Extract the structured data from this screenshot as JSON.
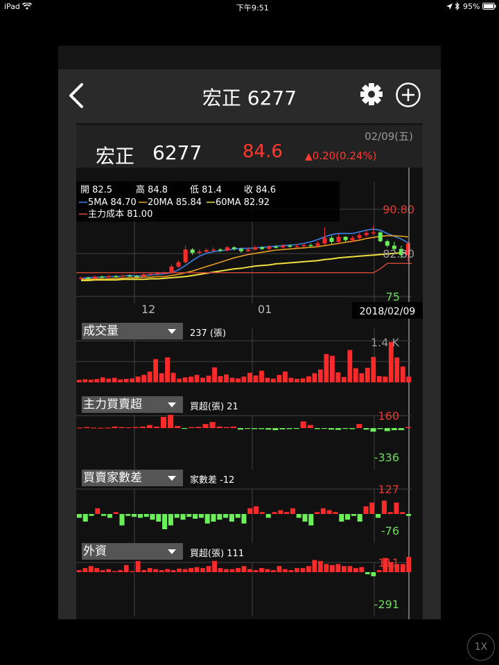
{
  "status_bar": {
    "device": "iPad",
    "time": "下午9:51",
    "battery": "95%"
  },
  "header": {
    "title": "宏正 6277"
  },
  "quote": {
    "date": "02/09(五)",
    "name": "宏正",
    "code": "6277",
    "price": "84.6",
    "change": "0.20(0.24%)",
    "change_color": "#ff3b30"
  },
  "ohlc": {
    "open": "開 82.5",
    "high": "高 84.8",
    "low": "低 81.4",
    "close": "收 84.6"
  },
  "ma": {
    "ma5": "5MA 84.70",
    "ma20": "20MA 85.84",
    "ma60": "60MA 82.92",
    "cost": "主力成本 81.00"
  },
  "price_axis": {
    "top": "90.80",
    "mid": "82.80",
    "bottom": "75"
  },
  "x_axis": {
    "dec": "12",
    "jan": "01"
  },
  "crosshair_date": "2018/02/09",
  "colors": {
    "up": "#ff2a2a",
    "down": "#6cf05a",
    "ma5": "#3d82e6",
    "ma20": "#e8a020",
    "ma60": "#f0e040",
    "cost": "#d9483b",
    "background": "#111111"
  },
  "indicators": [
    {
      "label": "成交量",
      "value": "237 (張)",
      "axis_top": "1.4 K",
      "axis_bottom": ""
    },
    {
      "label": "主力買賣超",
      "value": "買超(張) 21",
      "axis_top": "160",
      "axis_bottom": "-336"
    },
    {
      "label": "買賣家數差",
      "value": "家數差 -12",
      "axis_top": "127",
      "axis_bottom": "-76"
    },
    {
      "label": "外資",
      "value": "買超(張) 111",
      "axis_top": "111",
      "axis_bottom": "-291"
    }
  ],
  "zoom_label": "1X",
  "chart_data": [
    {
      "type": "candlestick",
      "title": "",
      "y_range": [
        75,
        90.8
      ],
      "series": [
        {
          "name": "5MA",
          "values": [
            78.3,
            78.4,
            78.5,
            78.5,
            78.6,
            78.6,
            78.7,
            78.8,
            78.7,
            78.8,
            78.9,
            79.0,
            79.1,
            79.3,
            79.8,
            80.6,
            81.5,
            82.3,
            82.8,
            83.1,
            83.3,
            83.4,
            83.6,
            83.7,
            83.7,
            83.8,
            83.9,
            84.0,
            84.1,
            84.2,
            84.3,
            84.4,
            84.6,
            84.9,
            85.3,
            85.8,
            86.2,
            86.4,
            86.4,
            86.4,
            86.7,
            87.0,
            87.2,
            87.0,
            86.4,
            85.9,
            85.4,
            84.7
          ]
        },
        {
          "name": "20MA",
          "values": [
            78.1,
            78.1,
            78.2,
            78.2,
            78.2,
            78.3,
            78.3,
            78.4,
            78.4,
            78.5,
            78.5,
            78.6,
            78.6,
            78.8,
            79.0,
            79.3,
            79.6,
            80.0,
            80.4,
            80.8,
            81.2,
            81.6,
            82.0,
            82.3,
            82.6,
            82.8,
            83.0,
            83.2,
            83.4,
            83.5,
            83.6,
            83.7,
            83.8,
            83.9,
            84.0,
            84.2,
            84.4,
            84.6,
            84.8,
            85.0,
            85.2,
            85.5,
            85.7,
            85.9,
            86.0,
            86.0,
            85.9,
            85.8
          ]
        },
        {
          "name": "60MA",
          "values": [
            77.9,
            77.9,
            78.0,
            78.0,
            78.0,
            78.0,
            78.1,
            78.1,
            78.1,
            78.1,
            78.2,
            78.2,
            78.3,
            78.4,
            78.5,
            78.6,
            78.8,
            79.0,
            79.2,
            79.4,
            79.6,
            79.8,
            80.0,
            80.1,
            80.3,
            80.5,
            80.6,
            80.7,
            80.9,
            81.0,
            81.1,
            81.2,
            81.3,
            81.4,
            81.5,
            81.7,
            81.8,
            82.0,
            82.1,
            82.2,
            82.3,
            82.4,
            82.5,
            82.6,
            82.7,
            82.8,
            82.9,
            82.9
          ]
        },
        {
          "name": "主力成本",
          "values": [
            79.3,
            79.3,
            79.3,
            79.3,
            79.3,
            79.3,
            79.3,
            79.3,
            79.3,
            79.3,
            79.3,
            79.3,
            79.3,
            79.3,
            79.3,
            79.3,
            79.3,
            79.3,
            79.3,
            79.3,
            79.3,
            79.3,
            79.3,
            79.3,
            79.3,
            79.3,
            79.3,
            79.3,
            79.3,
            79.3,
            79.3,
            79.3,
            79.3,
            79.3,
            79.3,
            79.3,
            79.3,
            79.3,
            79.3,
            79.3,
            79.3,
            79.3,
            79.3,
            80.0,
            81.0,
            81.0,
            81.0,
            81.0
          ]
        }
      ],
      "open": [
        78.2,
        78.4,
        78.3,
        78.6,
        78.5,
        78.7,
        78.6,
        78.8,
        78.7,
        78.6,
        79.0,
        79.1,
        79.2,
        79.3,
        80.4,
        81.2,
        83.5,
        82.9,
        83.1,
        83.4,
        83.5,
        83.3,
        83.9,
        83.6,
        83.2,
        83.5,
        83.9,
        83.6,
        84.0,
        83.9,
        84.2,
        84.0,
        84.1,
        84.3,
        84.2,
        84.6,
        85.6,
        84.9,
        85.8,
        85.2,
        85.6,
        86.1,
        86.5,
        86.6,
        85.0,
        84.2,
        83.6,
        82.5
      ],
      "close": [
        78.4,
        78.3,
        78.6,
        78.5,
        78.7,
        78.6,
        78.8,
        78.7,
        78.6,
        79.0,
        79.1,
        79.2,
        79.3,
        80.4,
        81.2,
        83.5,
        82.9,
        83.1,
        83.4,
        83.5,
        83.3,
        83.9,
        83.6,
        83.2,
        83.5,
        83.9,
        83.6,
        84.0,
        83.9,
        84.2,
        84.0,
        84.1,
        84.3,
        84.2,
        84.6,
        85.6,
        84.9,
        85.8,
        85.2,
        85.6,
        86.1,
        86.5,
        86.6,
        85.0,
        84.2,
        83.6,
        82.5,
        84.6
      ],
      "high": [
        78.6,
        78.6,
        78.8,
        78.8,
        78.9,
        78.9,
        79.0,
        79.0,
        78.9,
        79.2,
        79.3,
        79.4,
        79.5,
        80.8,
        81.6,
        84.2,
        83.8,
        83.5,
        83.8,
        83.9,
        83.8,
        84.2,
        84.1,
        83.8,
        83.9,
        84.2,
        84.1,
        84.3,
        84.3,
        84.5,
        84.4,
        84.5,
        84.6,
        84.6,
        85.0,
        87.5,
        86.0,
        86.3,
        85.9,
        86.0,
        86.5,
        87.0,
        87.8,
        86.8,
        85.3,
        84.9,
        84.2,
        84.8
      ],
      "low": [
        78.0,
        78.1,
        78.1,
        78.3,
        78.3,
        78.4,
        78.4,
        78.5,
        78.4,
        78.4,
        78.8,
        78.9,
        79.0,
        79.1,
        80.1,
        81.0,
        82.5,
        82.6,
        82.9,
        83.2,
        83.0,
        83.1,
        83.3,
        82.9,
        83.0,
        83.3,
        83.4,
        83.4,
        83.7,
        83.7,
        83.8,
        83.8,
        83.9,
        84.0,
        84.0,
        84.3,
        84.5,
        84.6,
        84.9,
        84.9,
        85.3,
        85.8,
        86.2,
        84.8,
        83.9,
        83.2,
        81.9,
        81.4
      ]
    },
    {
      "type": "bar",
      "title": "成交量",
      "values": [
        60,
        75,
        65,
        80,
        120,
        90,
        110,
        70,
        85,
        95,
        140,
        180,
        260,
        560,
        220,
        600,
        230,
        90,
        120,
        140,
        180,
        110,
        160,
        360,
        150,
        190,
        110,
        95,
        140,
        230,
        165,
        280,
        110,
        90,
        180,
        260,
        110,
        85,
        95,
        145,
        220,
        310,
        680,
        640,
        240,
        130,
        780,
        340,
        220,
        350,
        610,
        150,
        140,
        970,
        600,
        380,
        140
      ]
    },
    {
      "type": "bar",
      "title": "主力買賣超",
      "values": [
        10,
        20,
        10,
        5,
        10,
        30,
        20,
        15,
        20,
        30,
        60,
        30,
        220,
        260,
        40,
        -10,
        20,
        25,
        80,
        120,
        30,
        20,
        30,
        -30,
        -10,
        -20,
        -20,
        -30,
        -40,
        -25,
        -20,
        -10,
        130,
        60,
        -20,
        -10,
        -30,
        -35,
        -10,
        -20,
        80,
        -30,
        -70,
        -20,
        -60,
        -40,
        -40,
        20
      ]
    },
    {
      "type": "bar",
      "title": "買賣家數差",
      "values": [
        -20,
        -40,
        -10,
        30,
        -10,
        -20,
        10,
        -60,
        -10,
        -15,
        -20,
        -15,
        -30,
        -40,
        -80,
        -60,
        -20,
        -30,
        -15,
        -25,
        -20,
        -50,
        -40,
        -30,
        -20,
        -40,
        -20,
        -50,
        30,
        40,
        10,
        -20,
        10,
        20,
        10,
        30,
        -20,
        -40,
        -60,
        10,
        30,
        20,
        10,
        -40,
        -30,
        -10,
        -40,
        40,
        60,
        -20,
        70,
        10,
        60,
        10,
        -10
      ]
    },
    {
      "type": "bar",
      "title": "外資",
      "values": [
        20,
        40,
        60,
        40,
        20,
        30,
        10,
        20,
        70,
        10,
        110,
        20,
        40,
        30,
        20,
        30,
        20,
        35,
        30,
        40,
        50,
        40,
        60,
        110,
        40,
        30,
        30,
        40,
        60,
        30,
        20,
        40,
        30,
        20,
        60,
        30,
        20,
        40,
        40,
        60,
        120,
        110,
        80,
        70,
        80,
        60,
        60,
        40,
        50,
        -20,
        -40,
        20,
        140,
        100,
        80,
        80,
        150
      ]
    }
  ]
}
